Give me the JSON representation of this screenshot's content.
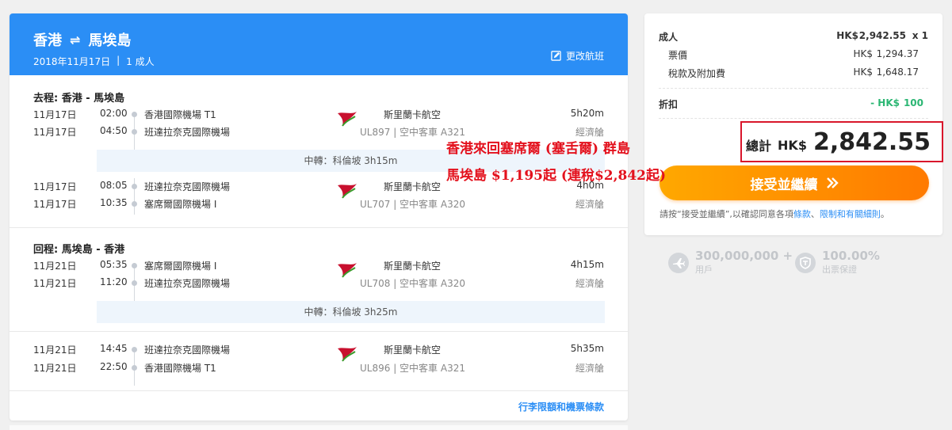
{
  "header": {
    "origin": "香港",
    "arrow": "⇌",
    "destination": "馬埃島",
    "date": "2018年11月17日",
    "separator": "|",
    "passengers": "1 成人",
    "change_label": "更改航班",
    "bg_color": "#2b8ef5"
  },
  "outbound": {
    "title": "去程: 香港 - 馬埃島",
    "seg1": {
      "dep_date": "11月17日",
      "dep_time": "02:00",
      "dep_airport": "香港國際機場 T1",
      "arr_date": "11月17日",
      "arr_time": "04:50",
      "arr_airport": "班達拉奈克國際機場",
      "airline": "斯里蘭卡航空",
      "flight": "UL897 | 空中客車 A321",
      "duration": "5h20m",
      "cabin": "經濟艙"
    },
    "layover": "中轉：科倫坡 3h15m",
    "seg2": {
      "dep_date": "11月17日",
      "dep_time": "08:05",
      "dep_airport": "班達拉奈克國際機場",
      "arr_date": "11月17日",
      "arr_time": "10:35",
      "arr_airport": "塞席爾國際機場 I",
      "airline": "斯里蘭卡航空",
      "flight": "UL707 | 空中客車 A320",
      "duration": "4h0m",
      "cabin": "經濟艙"
    }
  },
  "return": {
    "title": "回程: 馬埃島 - 香港",
    "seg1": {
      "dep_date": "11月21日",
      "dep_time": "05:35",
      "dep_airport": "塞席爾國際機場 I",
      "arr_date": "11月21日",
      "arr_time": "11:20",
      "arr_airport": "班達拉奈克國際機場",
      "airline": "斯里蘭卡航空",
      "flight": "UL708 | 空中客車 A320",
      "duration": "4h15m",
      "cabin": "經濟艙"
    },
    "layover": "中轉：科倫坡 3h25m",
    "seg2": {
      "dep_date": "11月21日",
      "dep_time": "14:45",
      "dep_airport": "班達拉奈克國際機場",
      "arr_date": "11月21日",
      "arr_time": "22:50",
      "arr_airport": "香港國際機場 T1",
      "airline": "斯里蘭卡航空",
      "flight": "UL896 | 空中客車 A321",
      "duration": "5h35m",
      "cabin": "經濟艙"
    }
  },
  "terms_link": "行李限額和機票條款",
  "pricing": {
    "adult_label": "成人",
    "adult_currency": "HK$",
    "adult_amount": "2,942.55",
    "adult_qty": "x 1",
    "fare_label": "票價",
    "fare_currency": "HK$",
    "fare_amount": "1,294.37",
    "tax_label": "稅款及附加費",
    "tax_currency": "HK$",
    "tax_amount": "1,648.17",
    "discount_label": "折扣",
    "discount_currency": "- HK$",
    "discount_amount": "100",
    "total_label": "總計",
    "total_currency": "HK$",
    "total_amount": "2,842.55",
    "accept_label": "接受並繼續",
    "consent_prefix": "請按“接受並繼續”,以確認同意各項",
    "consent_terms": "條款",
    "consent_sep": "、",
    "consent_rules": "限制和有關細則",
    "consent_suffix": "。",
    "discount_color": "#2bb673",
    "accent_color": "#ff8c00"
  },
  "badges": {
    "users_count": "300,000,000 +",
    "users_label": "用戶",
    "guarantee_pct": "100.00%",
    "guarantee_label": "出票保證"
  },
  "overlay": {
    "line1": "香港來回塞席爾 (塞舌爾) 群島",
    "line2": "馬埃島 $1,195起 (連稅$2,842起)"
  }
}
